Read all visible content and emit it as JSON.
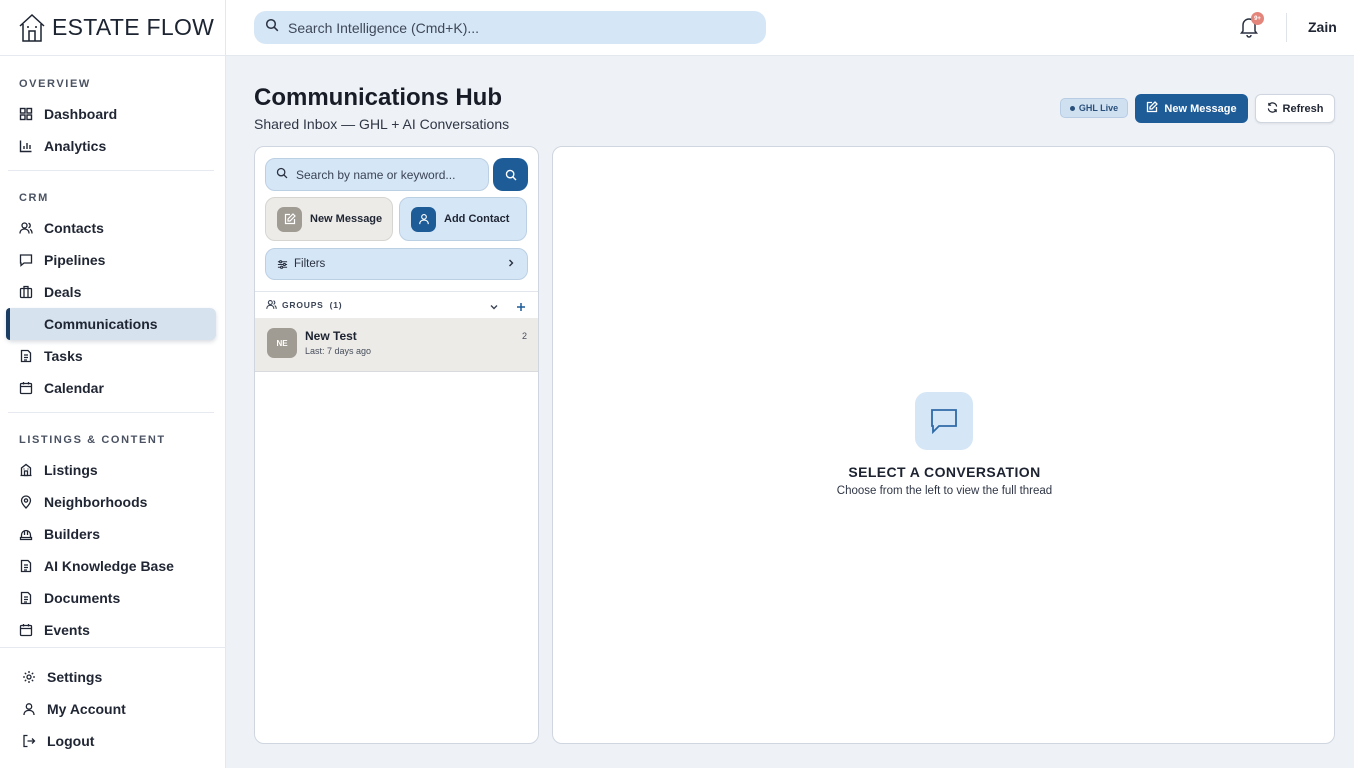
{
  "brand": {
    "name": "ESTATE FLOW"
  },
  "sidebar": {
    "sections": {
      "overview": "OVERVIEW",
      "crm": "CRM",
      "listings": "LISTINGS & CONTENT"
    },
    "items": {
      "dashboard": "Dashboard",
      "analytics": "Analytics",
      "contacts": "Contacts",
      "pipelines": "Pipelines",
      "deals": "Deals",
      "communications": "Communications",
      "tasks": "Tasks",
      "calendar": "Calendar",
      "listings": "Listings",
      "neighborhoods": "Neighborhoods",
      "builders": "Builders",
      "knowledge_base": "AI Knowledge Base",
      "documents": "Documents",
      "events": "Events"
    },
    "bottom": {
      "settings": "Settings",
      "account": "My Account",
      "logout": "Logout"
    }
  },
  "topbar": {
    "search_placeholder": "Search Intelligence (Cmd+K)...",
    "notification_badge": "9+",
    "user_name": "Zain"
  },
  "main": {
    "title": "Communications Hub",
    "subtitle": "Shared Inbox — GHL + AI Conversations",
    "status_badge": "GHL Live",
    "new_message_button": "New Message",
    "refresh_button": "Refresh"
  },
  "inbox": {
    "search_placeholder": "Search by name or keyword...",
    "new_message": "New Message",
    "add_contact": "Add Contact",
    "filters": "Filters",
    "groups_label": "GROUPS",
    "groups_count": "(1)",
    "conversations": [
      {
        "initials": "NE",
        "name": "New Test",
        "last": "Last: 7 days ago",
        "count": "2"
      }
    ]
  },
  "thread": {
    "empty_title": "SELECT A CONVERSATION",
    "empty_subtitle": "Choose from the left to view the full thread"
  },
  "colors": {
    "accent": "#1e5c98",
    "light_accent": "#d5e6f6",
    "active_nav": "#d6e2ee",
    "badge_red": "#e4857c"
  }
}
